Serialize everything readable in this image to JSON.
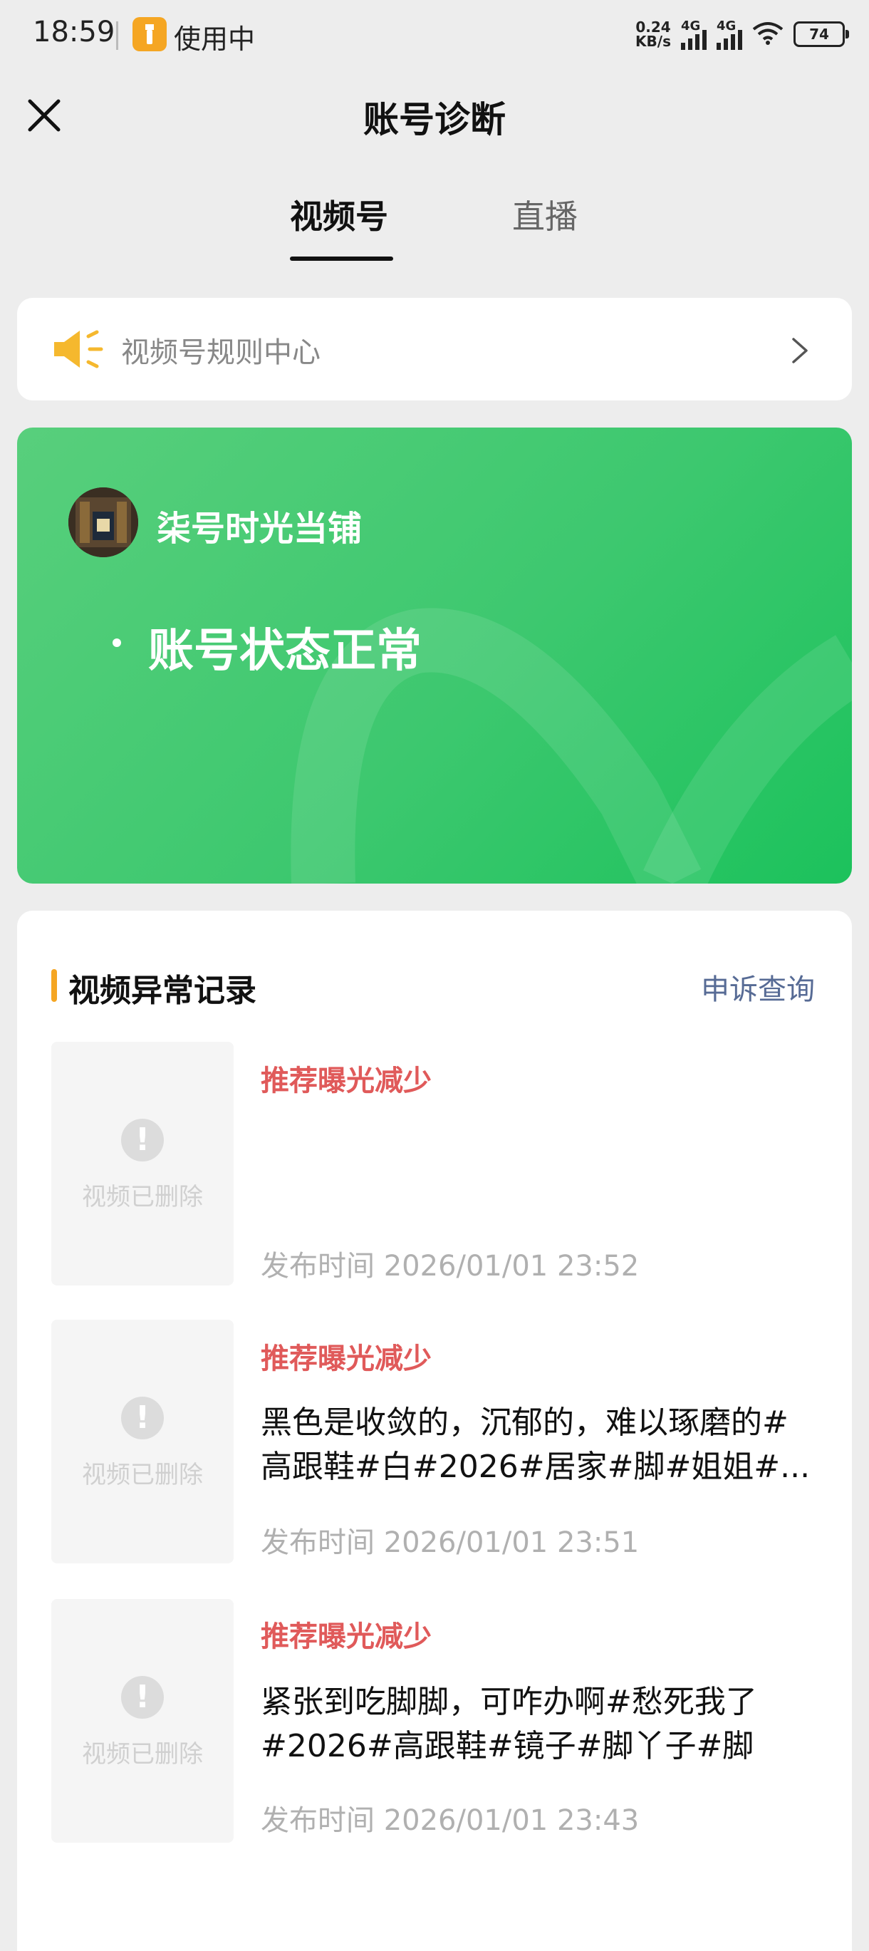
{
  "status_bar": {
    "time": "18:59",
    "app_text": "使用中",
    "net_speed_value": "0.24",
    "net_speed_unit": "KB/s",
    "signal1": "4G",
    "signal2": "4G",
    "battery": "74"
  },
  "header": {
    "title": "账号诊断"
  },
  "tabs": [
    {
      "label": "视频号",
      "active": true
    },
    {
      "label": "直播",
      "active": false
    }
  ],
  "rules": {
    "label": "视频号规则中心"
  },
  "account": {
    "name": "柒号时光当铺",
    "status": "账号状态正常"
  },
  "records": {
    "title": "视频异常记录",
    "appeal_link": "申诉查询",
    "items": [
      {
        "thumb_text": "视频已删除",
        "tag": "推荐曝光减少",
        "desc": "",
        "time": "发布时间 2026/01/01 23:52"
      },
      {
        "thumb_text": "视频已删除",
        "tag": "推荐曝光减少",
        "desc": "黑色是收敛的，沉郁的，难以琢磨的#高跟鞋#白#2026#居家#脚#姐姐#...",
        "time": "发布时间 2026/01/01 23:51"
      },
      {
        "thumb_text": "视频已删除",
        "tag": "推荐曝光减少",
        "desc": "紧张到吃脚脚，可咋办啊#愁死我了#2026#高跟鞋#镜子#脚丫子#脚",
        "time": "发布时间 2026/01/01 23:43"
      }
    ]
  },
  "colors": {
    "accent_green": "#3dc86f",
    "warning_red": "#e05a5a",
    "link_blue": "#576b95",
    "accent_orange": "#f5a623"
  }
}
